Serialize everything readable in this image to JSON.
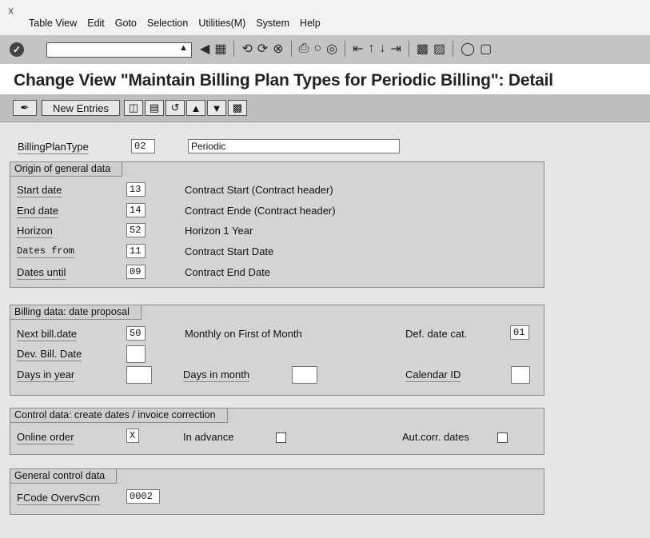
{
  "menu": {
    "items": [
      "Table View",
      "Edit",
      "Goto",
      "Selection",
      "Utilities(M)",
      "System",
      "Help"
    ]
  },
  "toolbar": {
    "icons": [
      "check-icon",
      "command-field",
      "enter-icon",
      "back-icon",
      "save-icon",
      "back-nav-icon",
      "exit-icon",
      "cancel-icon",
      "print-icon",
      "find-icon",
      "find-next-icon",
      "first-page-icon",
      "prev-page-icon",
      "next-page-icon",
      "last-page-icon",
      "new-session-icon",
      "shortcut-icon",
      "help-icon",
      "layout-icon"
    ]
  },
  "title": "Change View \"Maintain Billing Plan Types for Periodic Billing\": Detail",
  "app_toolbar": {
    "new_entries_label": "New Entries"
  },
  "header": {
    "billing_plan_type_label": "BillingPlanType",
    "billing_plan_type_value": "02",
    "billing_plan_type_desc": "Periodic"
  },
  "origin": {
    "title": "Origin of general data",
    "rows": [
      {
        "label": "Start date",
        "value": "13",
        "desc": "Contract Start (Contract header)"
      },
      {
        "label": "End date",
        "value": "14",
        "desc": "Contract Ende (Contract header)"
      },
      {
        "label": "Horizon",
        "value": "52",
        "desc": "Horizon 1 Year"
      },
      {
        "label": "Dates from",
        "value": "11",
        "desc": "Contract Start Date"
      },
      {
        "label": "Dates until",
        "value": "09",
        "desc": "Contract End Date"
      }
    ]
  },
  "billing": {
    "title": "Billing data: date proposal",
    "next_bill_label": "Next bill.date",
    "next_bill_value": "50",
    "next_bill_desc": "Monthly on First of Month",
    "def_date_cat_label": "Def. date cat.",
    "def_date_cat_value": "01",
    "dev_bill_label": "Dev. Bill. Date",
    "dev_bill_value": "",
    "days_in_year_label": "Days in year",
    "days_in_year_value": "",
    "days_in_month_label": "Days in month",
    "days_in_month_value": "",
    "calendar_id_label": "Calendar ID",
    "calendar_id_value": ""
  },
  "control": {
    "title": "Control data: create dates / invoice correction",
    "online_order_label": "Online order",
    "online_order_value": "X",
    "in_advance_label": "In advance",
    "in_advance_checked": false,
    "aut_corr_label": "Aut.corr. dates",
    "aut_corr_checked": false
  },
  "general": {
    "title": "General control data",
    "fcode_label": "FCode OvervScrn",
    "fcode_value": "0002"
  }
}
